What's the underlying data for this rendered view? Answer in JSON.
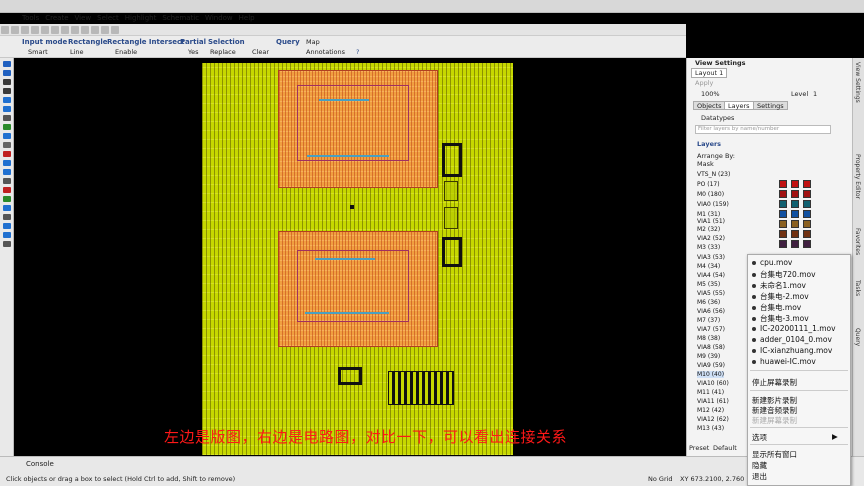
{
  "menubar": {
    "items": [
      "Tools",
      "Create",
      "View",
      "Select",
      "Highlight",
      "Schematic",
      "Window",
      "Help"
    ]
  },
  "options": {
    "input_mode": {
      "label": "Input mode",
      "value": "Smart"
    },
    "rectangle": {
      "label": "Rectangle",
      "value": "Line"
    },
    "rect_intersect": {
      "label": "Rectangle Intersect",
      "value": "Enable"
    },
    "partial": {
      "label": "Partial",
      "value": "Yes"
    },
    "selection": {
      "label": "Selection",
      "value": "Replace",
      "clear": "Clear"
    },
    "query": {
      "label": "Query",
      "map": "Map",
      "annotations": "Annotations"
    }
  },
  "view_settings": {
    "title": "View Settings",
    "layout": "Layout 1",
    "apply": "Apply",
    "zoom": "100%",
    "level": "Level",
    "level_value": "1",
    "tabs": [
      "Objects",
      "Layers",
      "Settings"
    ],
    "datatypes": "Datatypes",
    "filter_placeholder": "Filter layers by name/number",
    "layers_heading": "Layers",
    "arrange_by": "Arrange By:",
    "arrange_value": "Mask",
    "layers": [
      "VTS_N (23)",
      "PO (17)",
      "M0 (180)",
      "VIA0 (159)",
      "M1 (31)",
      "VIA1 (51)",
      "M2 (32)",
      "VIA2 (52)",
      "M3 (33)",
      "VIA3 (53)",
      "M4 (34)",
      "VIA4 (54)",
      "M5 (35)",
      "VIA5 (55)",
      "M6 (36)",
      "VIA6 (56)",
      "M7 (37)",
      "VIA7 (57)",
      "M8 (38)",
      "VIA8 (58)",
      "M9 (39)",
      "VIA9 (59)",
      "M10 (40)",
      "VIA10 (60)",
      "M11 (41)",
      "VIA11 (61)",
      "M12 (42)",
      "VIA12 (62)",
      "M13 (43)"
    ],
    "preset": "Preset",
    "default": "Default"
  },
  "side_tabs": [
    "View Settings",
    "Property Editor",
    "Favorites",
    "Tasks",
    "Query"
  ],
  "context_menu": {
    "files": [
      "cpu.mov",
      "台集电720.mov",
      "未命名1.mov",
      "台集电-2.mov",
      "台集电.mov",
      "台集电-3.mov",
      "IC-20200111_1.mov",
      "adder_0104_0.mov",
      "IC-xianzhuang.mov",
      "huawei-IC.mov"
    ],
    "stop_recording": "停止屏幕录制",
    "new_movie": "新建影片录制",
    "new_audio": "新建音频录制",
    "new_screen": "新建屏幕录制",
    "options": "选项",
    "show_all": "显示所有窗口",
    "hide": "隐藏",
    "quit": "退出"
  },
  "subtitle": "左边是版图，右边是电路图，对比一下，可以看出连接关系",
  "status": {
    "console": "Console",
    "hint": "Click objects or drag a box to select (Hold Ctrl to add, Shift to remove)",
    "grid": "No Grid",
    "coords": "XY 673.2100, 2.760"
  },
  "colors": {
    "chip": "#c6d800",
    "block": "#f0a040",
    "subtitle": "#ff1818"
  }
}
